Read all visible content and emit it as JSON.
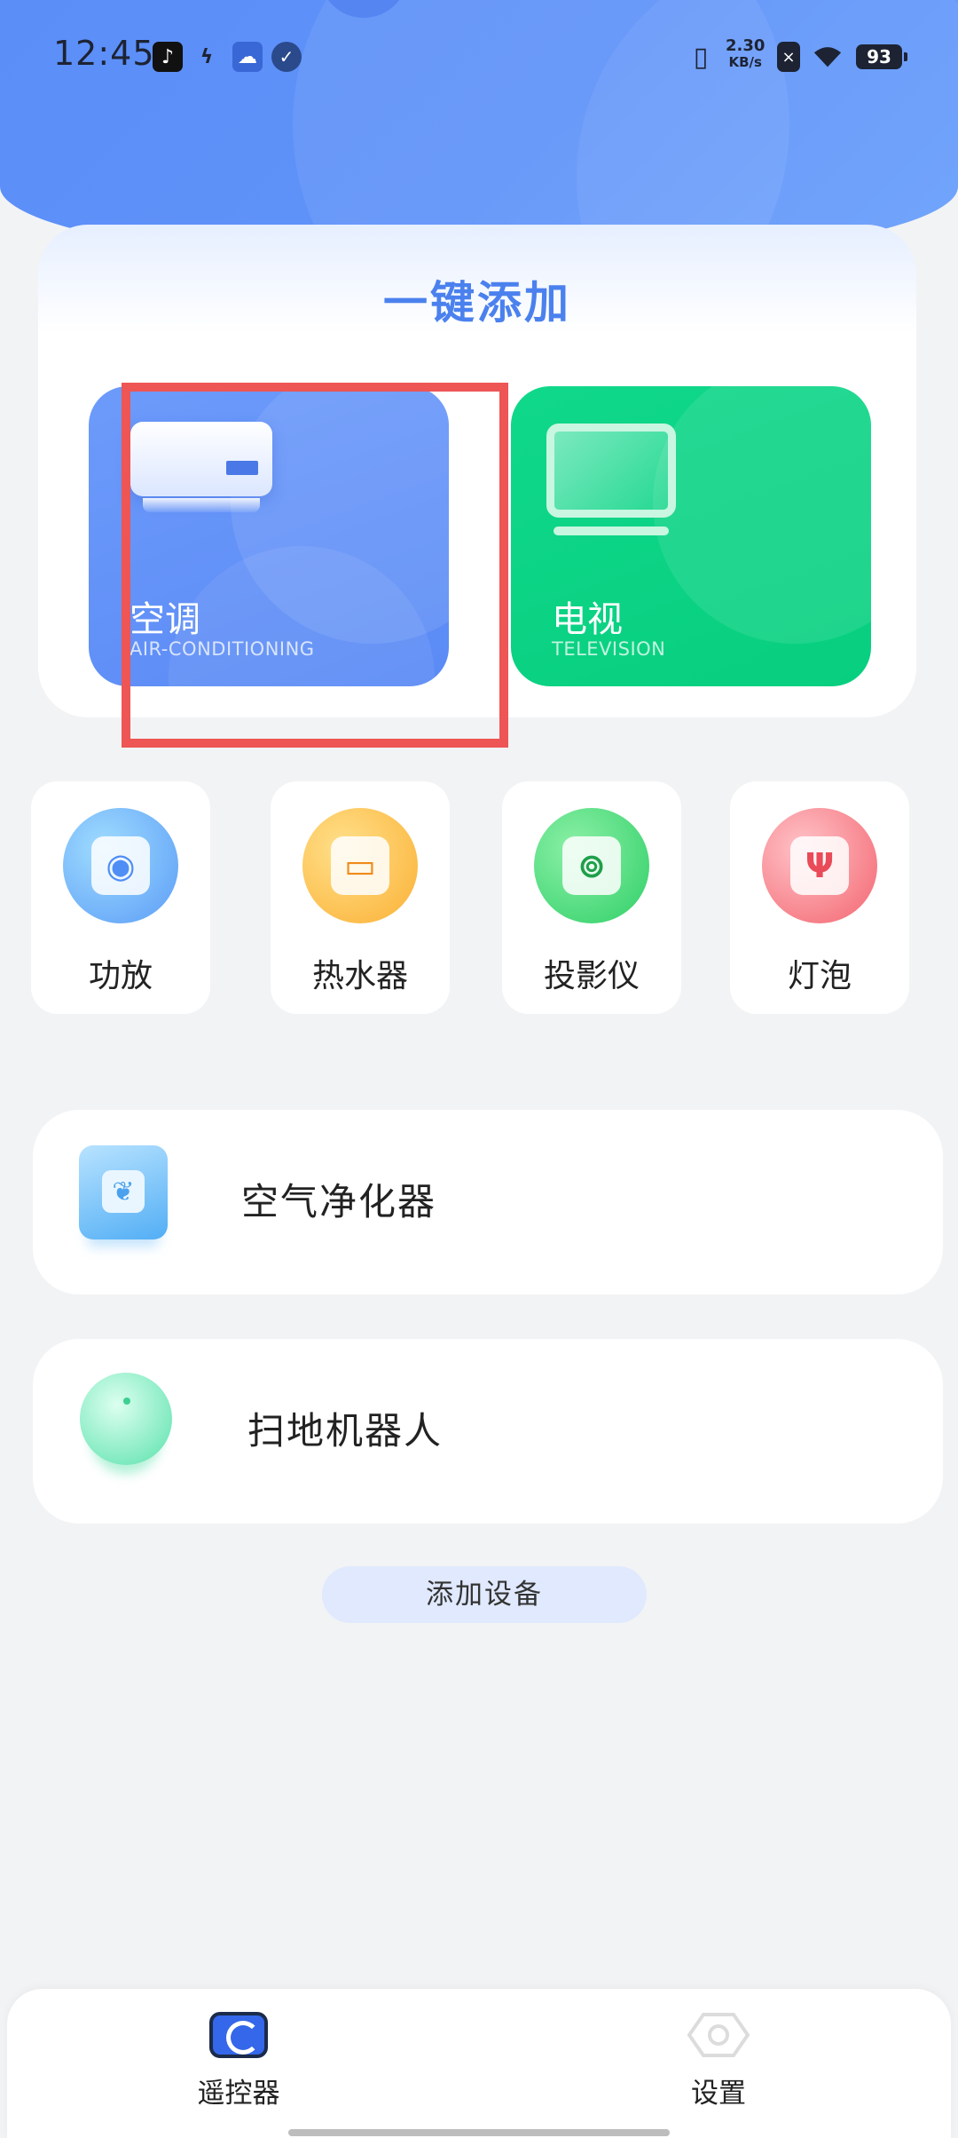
{
  "status_bar": {
    "time": "12:45",
    "net_speed_value": "2.30",
    "net_speed_unit": "KB/s",
    "battery": "93"
  },
  "quick_add": {
    "title": "一键添加",
    "tiles": [
      {
        "name": "空调",
        "subtitle": "AIR-CONDITIONING",
        "color": "#5f90f7"
      },
      {
        "name": "电视",
        "subtitle": "TELEVISION",
        "color": "#0bd484"
      }
    ]
  },
  "devices": [
    {
      "label": "功放",
      "icon": "amplifier-icon"
    },
    {
      "label": "热水器",
      "icon": "water-heater-icon"
    },
    {
      "label": "投影仪",
      "icon": "projector-icon"
    },
    {
      "label": "灯泡",
      "icon": "light-bulb-icon"
    }
  ],
  "rows": [
    {
      "label": "空气净化器",
      "icon": "air-purifier-icon"
    },
    {
      "label": "扫地机器人",
      "icon": "robot-vacuum-icon"
    }
  ],
  "add_device_label": "添加设备",
  "tabbar": {
    "tabs": [
      {
        "label": "遥控器",
        "icon": "remote-icon",
        "active": true
      },
      {
        "label": "设置",
        "icon": "settings-icon",
        "active": false
      }
    ]
  },
  "colors": {
    "accent": "#4b81ee",
    "highlight": "#ee5555"
  }
}
